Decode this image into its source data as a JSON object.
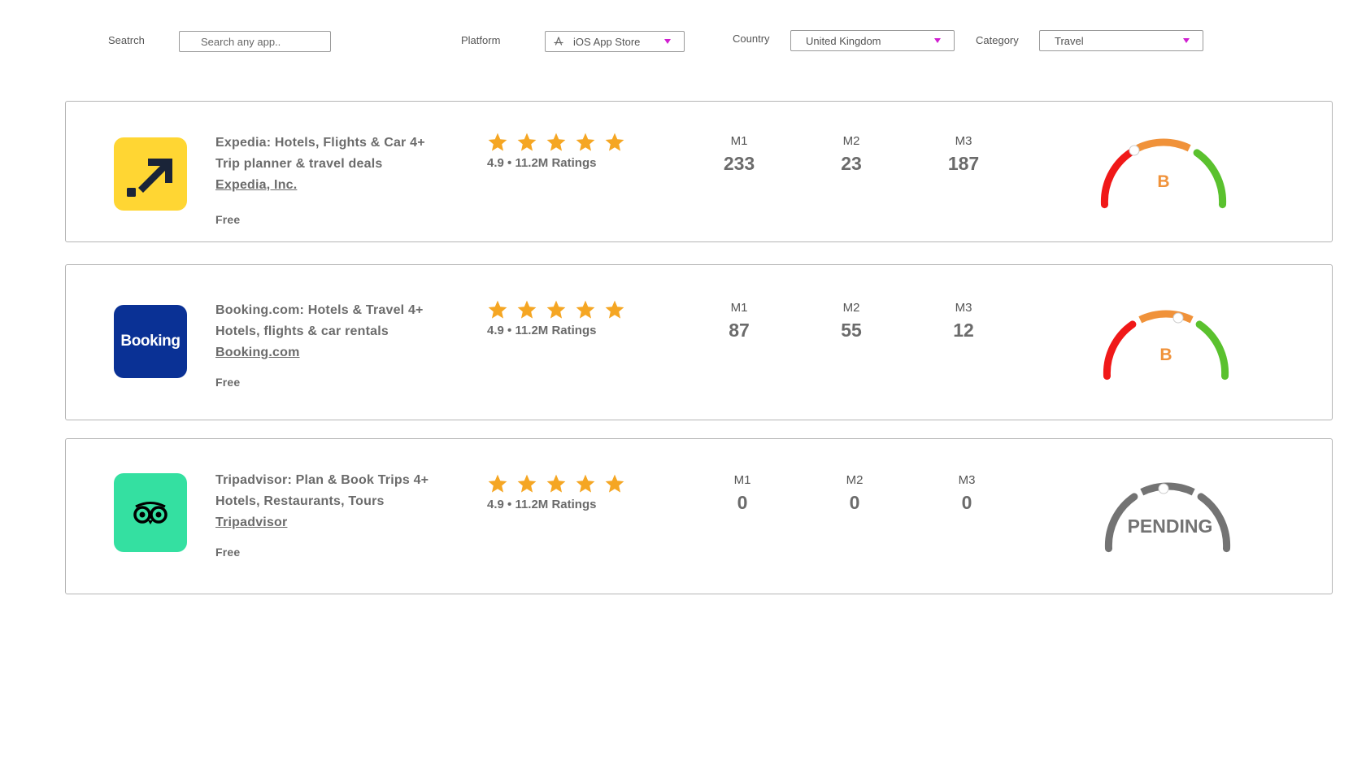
{
  "filters": {
    "search": {
      "label": "Seatrch",
      "placeholder": "Search any app.."
    },
    "platform": {
      "label": "Platform",
      "value": "iOS App Store"
    },
    "country": {
      "label": "Country",
      "value": "United Kingdom"
    },
    "category": {
      "label": "Category",
      "value": "Travel"
    }
  },
  "apps": [
    {
      "title": "Expedia: Hotels, Flights & Car 4+",
      "subtitle": "Trip planner & travel deals",
      "developer": "Expedia, Inc.",
      "price": "Free",
      "rating_text": "4.9 • 11.2M Ratings",
      "stars": 5,
      "metrics": [
        {
          "label": "M1",
          "value": "233"
        },
        {
          "label": "M2",
          "value": "23"
        },
        {
          "label": "M3",
          "value": "187"
        }
      ],
      "grade": "B",
      "icon_color": "#ffd633"
    },
    {
      "title": "Booking.com: Hotels & Travel 4+",
      "subtitle": "Hotels, flights & car rentals",
      "developer": "Booking.com",
      "price": "Free",
      "rating_text": "4.9 • 11.2M Ratings",
      "stars": 5,
      "metrics": [
        {
          "label": "M1",
          "value": "87"
        },
        {
          "label": "M2",
          "value": "55"
        },
        {
          "label": "M3",
          "value": "12"
        }
      ],
      "grade": "B",
      "icon_text": "Booking",
      "icon_color": "#0a3195"
    },
    {
      "title": "Tripadvisor: Plan & Book Trips 4+",
      "subtitle": "Hotels, Restaurants, Tours",
      "developer": "Tripadvisor",
      "price": "Free",
      "rating_text": "4.9 • 11.2M Ratings",
      "stars": 5,
      "metrics": [
        {
          "label": "M1",
          "value": "0"
        },
        {
          "label": "M2",
          "value": "0"
        },
        {
          "label": "M3",
          "value": "0"
        }
      ],
      "grade": "PENDING",
      "icon_color": "#34e0a1"
    }
  ],
  "colors": {
    "star": "#f5a623",
    "gauge_red": "#f01818",
    "gauge_orange": "#f0923a",
    "gauge_green": "#5ac12e",
    "gauge_pending": "#737373",
    "grade_text": "#f0923a",
    "caret": "#d01fd0"
  }
}
